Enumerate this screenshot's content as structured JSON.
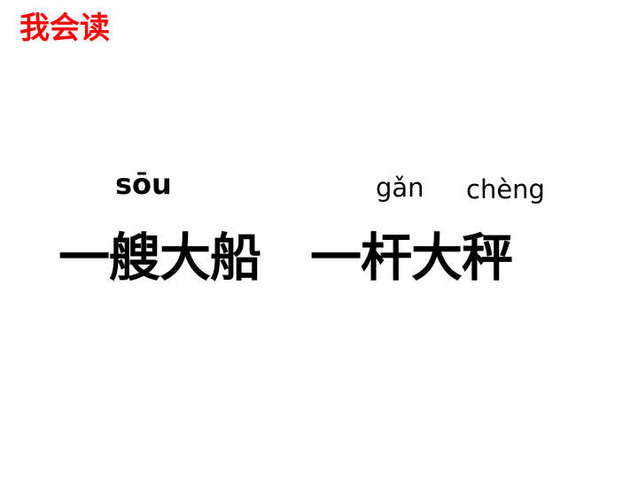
{
  "slide": {
    "heading": "我会读",
    "heading_color": "#ff0000",
    "items": [
      {
        "pinyin": "sōu",
        "phrase": "一艘大船"
      },
      {
        "pinyin": [
          "gǎn",
          "chèng"
        ],
        "phrase": "一杆大秤"
      }
    ]
  }
}
